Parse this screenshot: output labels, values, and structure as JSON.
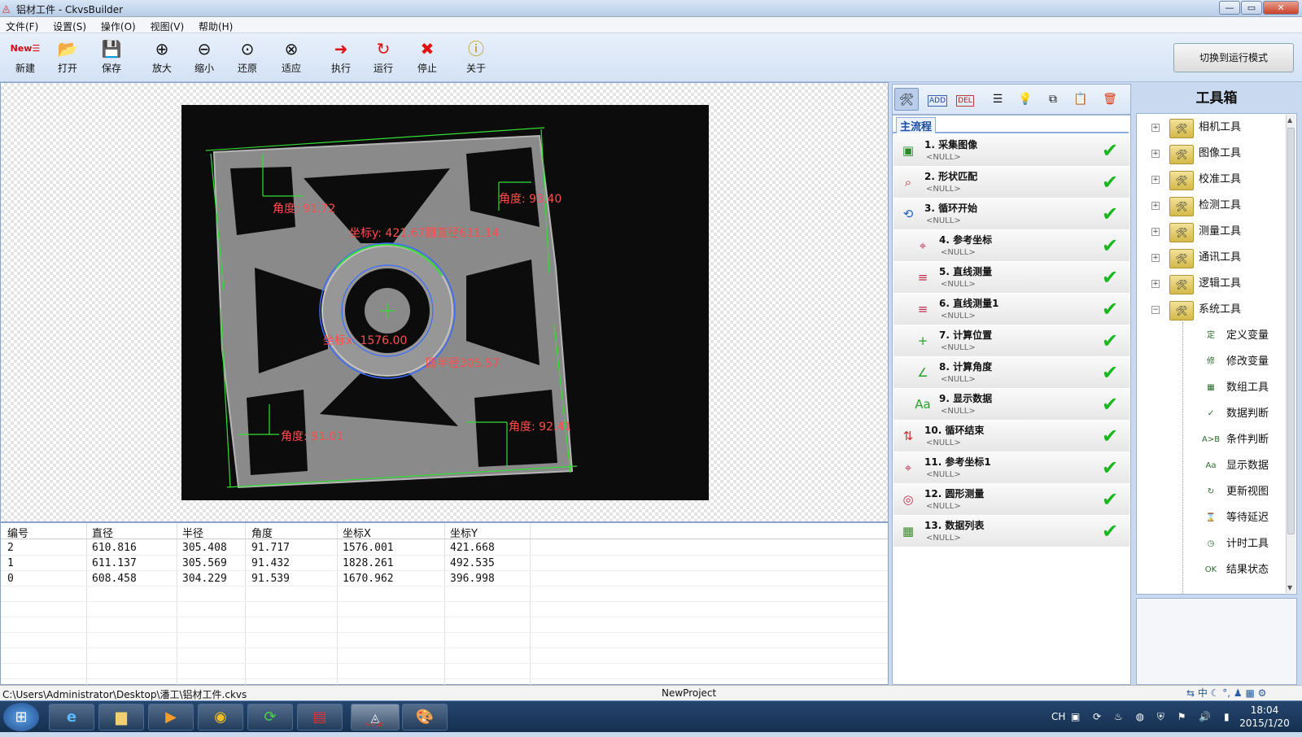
{
  "window": {
    "title": "铝材工件 - CkvsBuilder",
    "controls": [
      "—",
      "▭",
      "✕"
    ]
  },
  "menu": [
    "文件(F)",
    "设置(S)",
    "操作(O)",
    "视图(V)",
    "帮助(H)"
  ],
  "toolbar": {
    "items": [
      {
        "label": "新建",
        "icon": "new-icon"
      },
      {
        "label": "打开",
        "icon": "open-folder-icon"
      },
      {
        "label": "保存",
        "icon": "save-icon"
      },
      {
        "label": "放大",
        "icon": "zoom-in-icon"
      },
      {
        "label": "缩小",
        "icon": "zoom-out-icon"
      },
      {
        "label": "还原",
        "icon": "zoom-reset-icon"
      },
      {
        "label": "适应",
        "icon": "zoom-fit-icon"
      },
      {
        "label": "执行",
        "icon": "execute-arrow-icon"
      },
      {
        "label": "运行",
        "icon": "run-cycle-icon"
      },
      {
        "label": "停止",
        "icon": "stop-x-icon"
      },
      {
        "label": "关于",
        "icon": "info-icon"
      }
    ],
    "new_badge": "New",
    "run_mode_label": "切换到运行模式"
  },
  "overlay": {
    "angle_tl": "角度: 91.72",
    "angle_tr": "角度: 93.40",
    "angle_bl": "角度: 91.01",
    "angle_br": "角度: 92.41",
    "coord_y_diam": "坐标y: 421.67圆直径611.14",
    "coord_x": "坐标x: 1576.00",
    "radius": "圆半径305.57"
  },
  "table": {
    "columns": [
      "编号",
      "直径",
      "半径",
      "角度",
      "坐标X",
      "坐标Y"
    ],
    "rows": [
      [
        "2",
        "610.816",
        "305.408",
        "91.717",
        "1576.001",
        "421.668"
      ],
      [
        "1",
        "611.137",
        "305.569",
        "91.432",
        "1828.261",
        "492.535"
      ],
      [
        "0",
        "608.458",
        "304.229",
        "91.539",
        "1670.962",
        "396.998"
      ]
    ]
  },
  "flow": {
    "tab": "主流程",
    "null_text": "<NULL>",
    "steps": [
      {
        "name": "1. 采集图像",
        "icon": "camera-capture-icon",
        "indent": false
      },
      {
        "name": "2. 形状匹配",
        "icon": "shape-match-icon",
        "indent": false
      },
      {
        "name": "3. 循环开始",
        "icon": "loop-start-icon",
        "indent": false
      },
      {
        "name": "4. 参考坐标",
        "icon": "reference-coord-icon",
        "indent": true
      },
      {
        "name": "5. 直线测量",
        "icon": "line-measure-icon",
        "indent": true
      },
      {
        "name": "6. 直线测量1",
        "icon": "line-measure-icon",
        "indent": true
      },
      {
        "name": "7. 计算位置",
        "icon": "calc-position-icon",
        "indent": true
      },
      {
        "name": "8. 计算角度",
        "icon": "calc-angle-icon",
        "indent": true
      },
      {
        "name": "9. 显示数据",
        "icon": "display-data-icon",
        "indent": true
      },
      {
        "name": "10. 循环结束",
        "icon": "loop-end-icon",
        "indent": false
      },
      {
        "name": "11. 参考坐标1",
        "icon": "reference-coord-icon",
        "indent": false
      },
      {
        "name": "12. 圆形测量",
        "icon": "circle-measure-icon",
        "indent": false
      },
      {
        "name": "13. 数据列表",
        "icon": "data-list-icon",
        "indent": false
      }
    ]
  },
  "toolbox": {
    "title": "工具箱",
    "categories": [
      "相机工具",
      "图像工具",
      "校准工具",
      "检测工具",
      "测量工具",
      "通讯工具",
      "逻辑工具",
      "系统工具"
    ],
    "system_tools": [
      "定义变量",
      "修改变量",
      "数组工具",
      "数据判断",
      "条件判断",
      "显示数据",
      "更新视图",
      "等待延迟",
      "计时工具",
      "结果状态"
    ]
  },
  "status": {
    "path": "C:\\Users\\Administrator\\Desktop\\潘工\\铝材工件.ckvs",
    "project": "NewProject"
  },
  "taskbar": {
    "time": "18:04",
    "date": "2015/1/20",
    "lang": "CH",
    "vision_label": "vision"
  },
  "colors": {
    "ok_green": "#19b81d",
    "overlay_red": "#ff4d4d",
    "edge_green": "#33dd33",
    "circle_blue": "#3a6cff"
  }
}
